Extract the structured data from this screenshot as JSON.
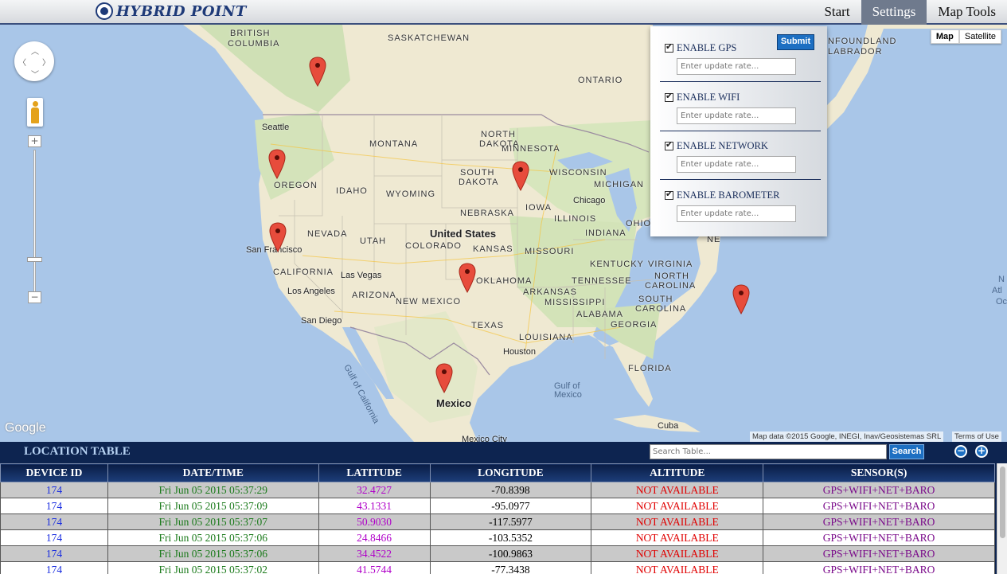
{
  "brand": {
    "name": "HYBRID POINT",
    "logo_icon": "target-logo-icon"
  },
  "nav": [
    {
      "label": "Start"
    },
    {
      "label": "Settings",
      "active": true
    },
    {
      "label": "Map Tools"
    }
  ],
  "map": {
    "map_type": {
      "map": "Map",
      "satellite": "Satellite",
      "selected": "Map"
    },
    "attribution": "Map data ©2015 Google, INEGI, Inav/Geosistemas SRL",
    "terms": "Terms of Use",
    "logo": "Google",
    "labels": {
      "british_columbia_1": "BRITISH",
      "british_columbia_2": "COLUMBIA",
      "saskatchewan": "SASKATCHEWAN",
      "newfoundland_1": "NFOUNDLAND",
      "newfoundland_2": "LABRADOR",
      "ontario": "ONTARIO",
      "seattle": "Seattle",
      "montana": "MONTANA",
      "north_dakota_1": "NORTH",
      "north_dakota_2": "DAKOTA",
      "minnesota": "MINNESOTA",
      "oregon": "OREGON",
      "idaho": "IDAHO",
      "wyoming": "WYOMING",
      "south_dakota_1": "SOUTH",
      "south_dakota_2": "DAKOTA",
      "wisconsin": "WISCONSIN",
      "michigan": "MICHIGAN",
      "chicago": "Chicago",
      "iowa": "IOWA",
      "nebraska": "NEBRASKA",
      "illinois": "ILLINOIS",
      "nevada": "NEVADA",
      "utah": "UTAH",
      "united_states": "United States",
      "colorado": "COLORADO",
      "kansas": "KANSAS",
      "missouri": "MISSOURI",
      "indiana": "INDIANA",
      "ohio": "OHIO",
      "san_francisco": "San Francisco",
      "kentucky": "KENTUCKY",
      "virginia": "VIRGINIA",
      "california": "CALIFORNIA",
      "las_vegas": "Las Vegas",
      "oklahoma": "OKLAHOMA",
      "tennessee": "TENNESSEE",
      "north_carolina_1": "NORTH",
      "north_carolina_2": "CAROLINA",
      "los_angeles": "Los Angeles",
      "arizona": "ARIZONA",
      "new_mexico": "NEW MEXICO",
      "arkansas": "ARKANSAS",
      "south_carolina_1": "SOUTH",
      "south_carolina_2": "CAROLINA",
      "mississippi": "MISSISSIPPI",
      "alabama": "ALABAMA",
      "san_diego": "San Diego",
      "texas": "TEXAS",
      "georgia": "GEORGIA",
      "louisiana": "LOUISIANA",
      "houston": "Houston",
      "gulf_of_california": "Gulf of California",
      "florida": "FLORIDA",
      "gulf_of_mexico_1": "Gulf of",
      "gulf_of_mexico_2": "Mexico",
      "mexico": "Mexico",
      "cuba": "Cuba",
      "mexico_city": "Mexico City",
      "north_atlantic_1": "N",
      "north_atlantic_2": "Atl",
      "north_atlantic_3": "Oc",
      "ne_edge": "NE"
    },
    "controls": {
      "zoom_in": "+",
      "zoom_out": "−",
      "zoom_minus2": "−"
    }
  },
  "settings": {
    "submit_label": "Submit",
    "options": [
      {
        "label": "ENABLE GPS",
        "placeholder": "Enter update rate..."
      },
      {
        "label": "ENABLE WIFI",
        "placeholder": "Enter update rate..."
      },
      {
        "label": "ENABLE NETWORK",
        "placeholder": "Enter update rate..."
      },
      {
        "label": "ENABLE BAROMETER",
        "placeholder": "Enter update rate..."
      }
    ]
  },
  "location_table": {
    "title": "LOCATION TABLE",
    "search_placeholder": "Search Table...",
    "search_button": "Search",
    "collapse_button": "−",
    "expand_button": "+",
    "columns": [
      "DEVICE ID",
      "DATE/TIME",
      "LATITUDE",
      "LONGITUDE",
      "ALTITUDE",
      "SENSOR(S)"
    ],
    "rows": [
      [
        "174",
        "Fri Jun 05 2015 05:37:29",
        "32.4727",
        "-70.8398",
        "NOT AVAILABLE",
        "GPS+WIFI+NET+BARO"
      ],
      [
        "174",
        "Fri Jun 05 2015 05:37:09",
        "43.1331",
        "-95.0977",
        "NOT AVAILABLE",
        "GPS+WIFI+NET+BARO"
      ],
      [
        "174",
        "Fri Jun 05 2015 05:37:07",
        "50.9030",
        "-117.5977",
        "NOT AVAILABLE",
        "GPS+WIFI+NET+BARO"
      ],
      [
        "174",
        "Fri Jun 05 2015 05:37:06",
        "24.8466",
        "-103.5352",
        "NOT AVAILABLE",
        "GPS+WIFI+NET+BARO"
      ],
      [
        "174",
        "Fri Jun 05 2015 05:37:06",
        "34.4522",
        "-100.9863",
        "NOT AVAILABLE",
        "GPS+WIFI+NET+BARO"
      ],
      [
        "174",
        "Fri Jun 05 2015 05:37:02",
        "41.5744",
        "-77.3438",
        "NOT AVAILABLE",
        "GPS+WIFI+NET+BARO"
      ]
    ]
  }
}
